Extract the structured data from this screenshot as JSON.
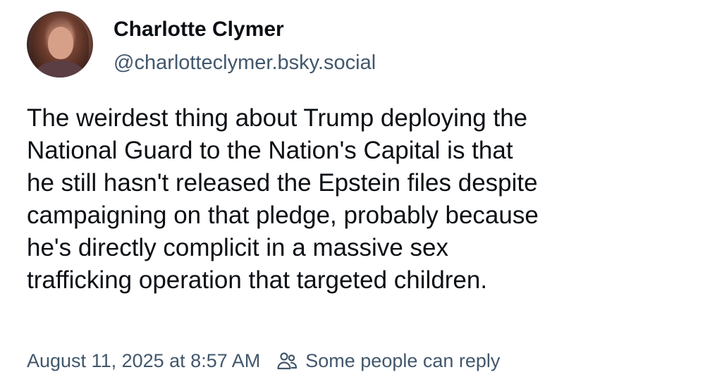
{
  "author": {
    "display_name": "Charlotte Clymer",
    "handle": "@charlotteclymer.bsky.social",
    "avatar_icon": "profile-photo"
  },
  "post": {
    "text_lines": [
      "The weirdest thing about Trump deploying the",
      "National Guard to the Nation's Capital is that",
      "he still hasn't released the Epstein files despite",
      "campaigning on that pledge, probably because",
      "he's directly complicit in a massive sex",
      "trafficking operation that targeted children."
    ]
  },
  "meta": {
    "timestamp": "August 11, 2025 at 8:57 AM",
    "reply_setting_icon": "people-icon",
    "reply_setting": "Some people can reply"
  },
  "colors": {
    "text": "#0b0f14",
    "secondary": "#42576c",
    "background": "#ffffff"
  }
}
